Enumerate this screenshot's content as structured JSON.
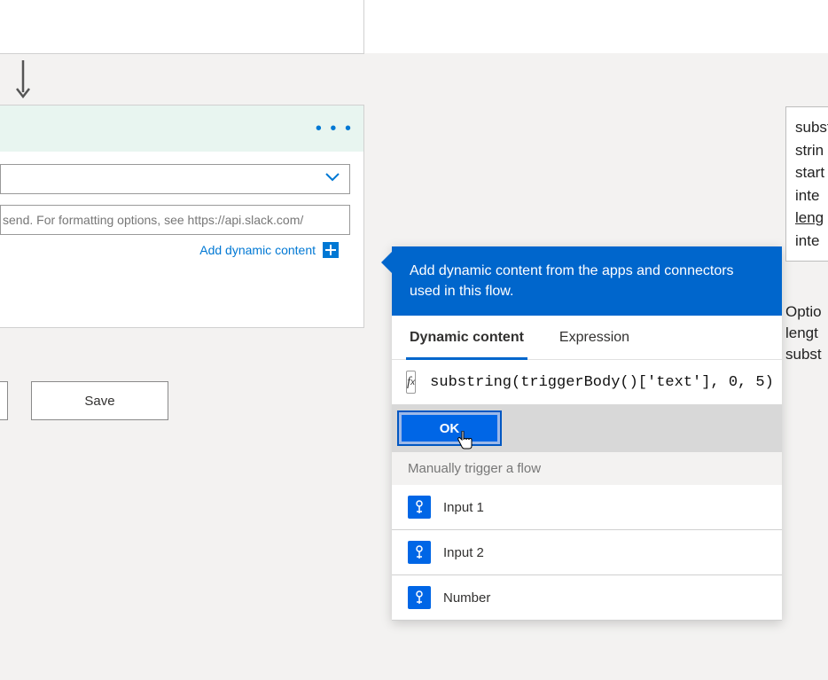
{
  "card": {
    "message_placeholder": "send. For formatting options, see https://api.slack.com/",
    "add_dynamic_link": "Add dynamic content"
  },
  "buttons": {
    "save": "Save"
  },
  "flyout": {
    "header": "Add dynamic content from the apps and connectors used in this flow.",
    "tab_dynamic": "Dynamic content",
    "tab_expression": "Expression",
    "fx_expression": "substring(triggerBody()['text'], 0, 5)",
    "ok": "OK",
    "section": "Manually trigger a flow",
    "tokens": [
      "Input 1",
      "Input 2",
      "Number"
    ]
  },
  "tooltip": {
    "lines": [
      "subst",
      "strin",
      "start",
      "inte",
      "leng",
      "inte"
    ],
    "desc": [
      "Optio",
      "lengt",
      "subst"
    ]
  },
  "chart_data": null
}
